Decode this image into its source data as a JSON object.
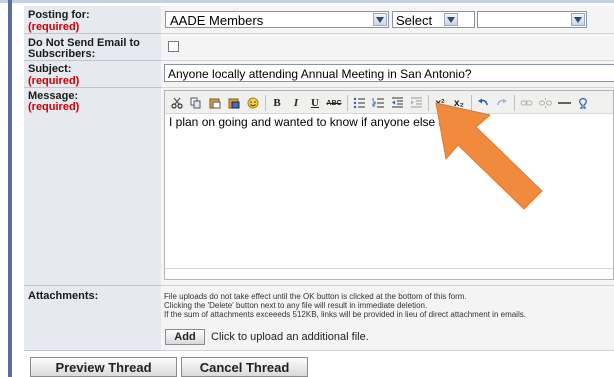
{
  "form": {
    "posting_for": {
      "label": "Posting for:",
      "required": "(required)",
      "value": "AADE Members",
      "select2": "Select",
      "select3": ""
    },
    "no_email": {
      "label_line1": "Do Not Send Email to",
      "label_line2": "Subscribers:"
    },
    "subject": {
      "label": "Subject:",
      "required": "(required)",
      "value": "Anyone locally attending Annual Meeting in San Antonio?"
    },
    "message": {
      "label": "Message:",
      "required": "(required)",
      "value": "I plan on going and wanted to know if anyone else is..."
    },
    "attachments": {
      "label": "Attachments:",
      "info_line1": "File uploads do not take effect until the OK button is clicked at the bottom of this form.",
      "info_line2": "Clicking the 'Delete' button next to any file will result in immediate deletion.",
      "info_line3": "If the sum of attachments exceeeds 512KB, links will be provided in lieu of direct attachment in emails.",
      "add_button": "Add",
      "add_hint": "Click to upload an additional file."
    }
  },
  "toolbar": {
    "bold": "B",
    "italic": "I",
    "underline": "U",
    "strike": "ABC",
    "superscript": "x²",
    "subscript": "x₂"
  },
  "buttons": {
    "preview": "Preview Thread",
    "cancel": "Cancel Thread"
  },
  "colors": {
    "arrow": "#f08a3c",
    "required": "#cc0000",
    "sidebar": "#5a6f9c"
  },
  "icons": [
    "cut-icon",
    "copy-icon",
    "paste-icon",
    "paste-word-icon",
    "smiley-icon",
    "bullet-list-icon",
    "numbered-list-icon",
    "outdent-icon",
    "indent-icon",
    "undo-icon",
    "redo-icon",
    "link-icon",
    "unlink-icon",
    "horizontal-rule-icon",
    "arrow-annotation"
  ]
}
